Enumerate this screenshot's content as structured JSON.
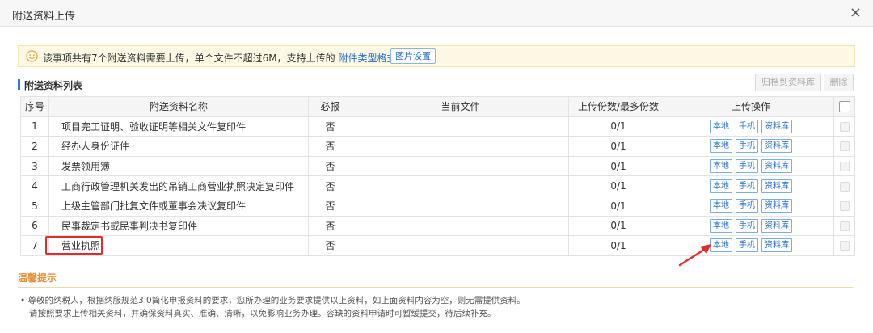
{
  "window": {
    "title": "附送资料上传",
    "close_glyph": "×"
  },
  "notice": {
    "text": "该事项共有7个附送资料需要上传，单个文件不超过6M，支持上传的",
    "link": "附件类型格式",
    "image_settings": "图片设置"
  },
  "section": {
    "title": "附送资料列表",
    "archive_button": "归档到资料库",
    "delete_button": "删除"
  },
  "table": {
    "headers": [
      "序号",
      "附送资料名称",
      "必报",
      "当前文件",
      "上传份数/最多份数",
      "上传操作",
      ""
    ],
    "action_labels": {
      "local": "本地",
      "mobile": "手机",
      "library": "资料库"
    },
    "rows": [
      {
        "no": "1",
        "name": "项目完工证明、验收证明等相关文件复印件",
        "required": "否",
        "file": "",
        "count": "0/1"
      },
      {
        "no": "2",
        "name": "经办人身份证件",
        "required": "否",
        "file": "",
        "count": "0/1"
      },
      {
        "no": "3",
        "name": "发票领用簿",
        "required": "否",
        "file": "",
        "count": "0/1"
      },
      {
        "no": "4",
        "name": "工商行政管理机关发出的吊销工商营业执照决定复印件",
        "required": "否",
        "file": "",
        "count": "0/1"
      },
      {
        "no": "5",
        "name": "上级主管部门批复文件或董事会决议复印件",
        "required": "否",
        "file": "",
        "count": "0/1"
      },
      {
        "no": "6",
        "name": "民事裁定书或民事判决书复印件",
        "required": "否",
        "file": "",
        "count": "0/1"
      },
      {
        "no": "7",
        "name": "营业执照",
        "required": "否",
        "file": "",
        "count": "0/1"
      }
    ]
  },
  "tips": {
    "title": "温馨提示",
    "line1": "• 尊敬的纳税人，根据纳服规范3.0简化申报资料的要求，您所办理的业务要求提供以上资料，如上面资料内容为空，则无需提供资料。",
    "line2": "请按照要求上传相关资料，并确保资料真实、准确、清晰，以免影响业务办理。容缺的资料申请时可暂缓提交，待后续补充。"
  },
  "colors": {
    "accent": "#2a6fc9",
    "highlight": "#e32b2b",
    "tip": "#e8913a",
    "notice_bg": "#fcf8e3"
  },
  "icons": {
    "notice": "smile-icon",
    "close": "close-icon",
    "arrow": "arrow-annotation-icon"
  }
}
